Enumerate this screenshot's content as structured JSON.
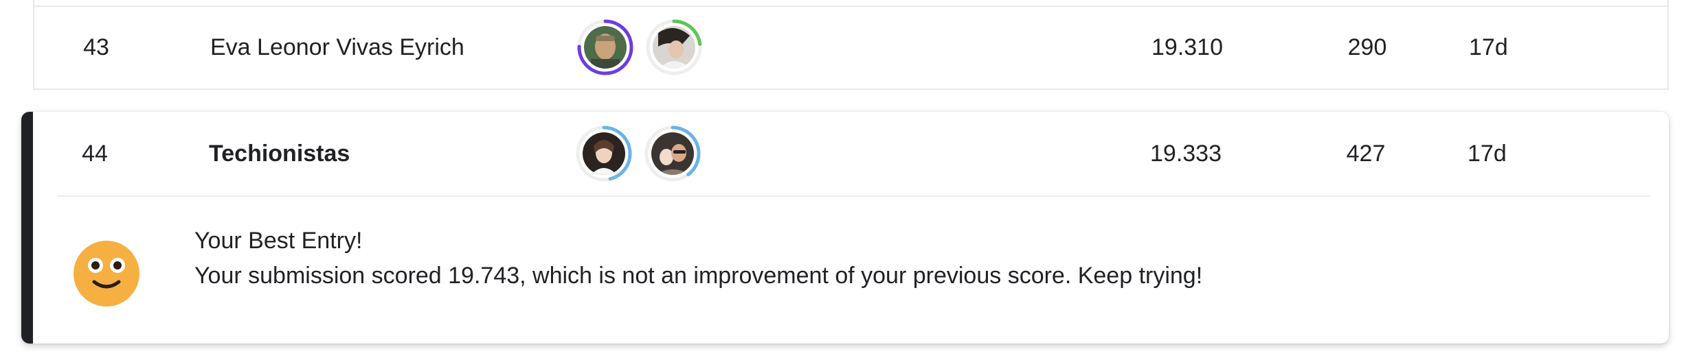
{
  "leaderboard": {
    "rows": [
      {
        "rank": "43",
        "team": "Eva Leonor Vivas Eyrich",
        "score": "19.310",
        "entries": "290",
        "last": "17d"
      },
      {
        "rank": "44",
        "team": "Techionistas",
        "score": "19.333",
        "entries": "427",
        "last": "17d"
      }
    ]
  },
  "submission_message": {
    "title": "Your Best Entry!",
    "body": "Your submission scored 19.743, which is not an improvement of your previous score. Keep trying!"
  },
  "colors": {
    "ring_purple": "#6c3ce6",
    "ring_green": "#5fc35a",
    "ring_blue": "#6bb3ea",
    "accent_bar": "#202124",
    "smiley": "#f5b041"
  },
  "icons": {
    "avatar_icon": "user-avatar-icon",
    "smiley_icon": "smiley-face-icon"
  }
}
